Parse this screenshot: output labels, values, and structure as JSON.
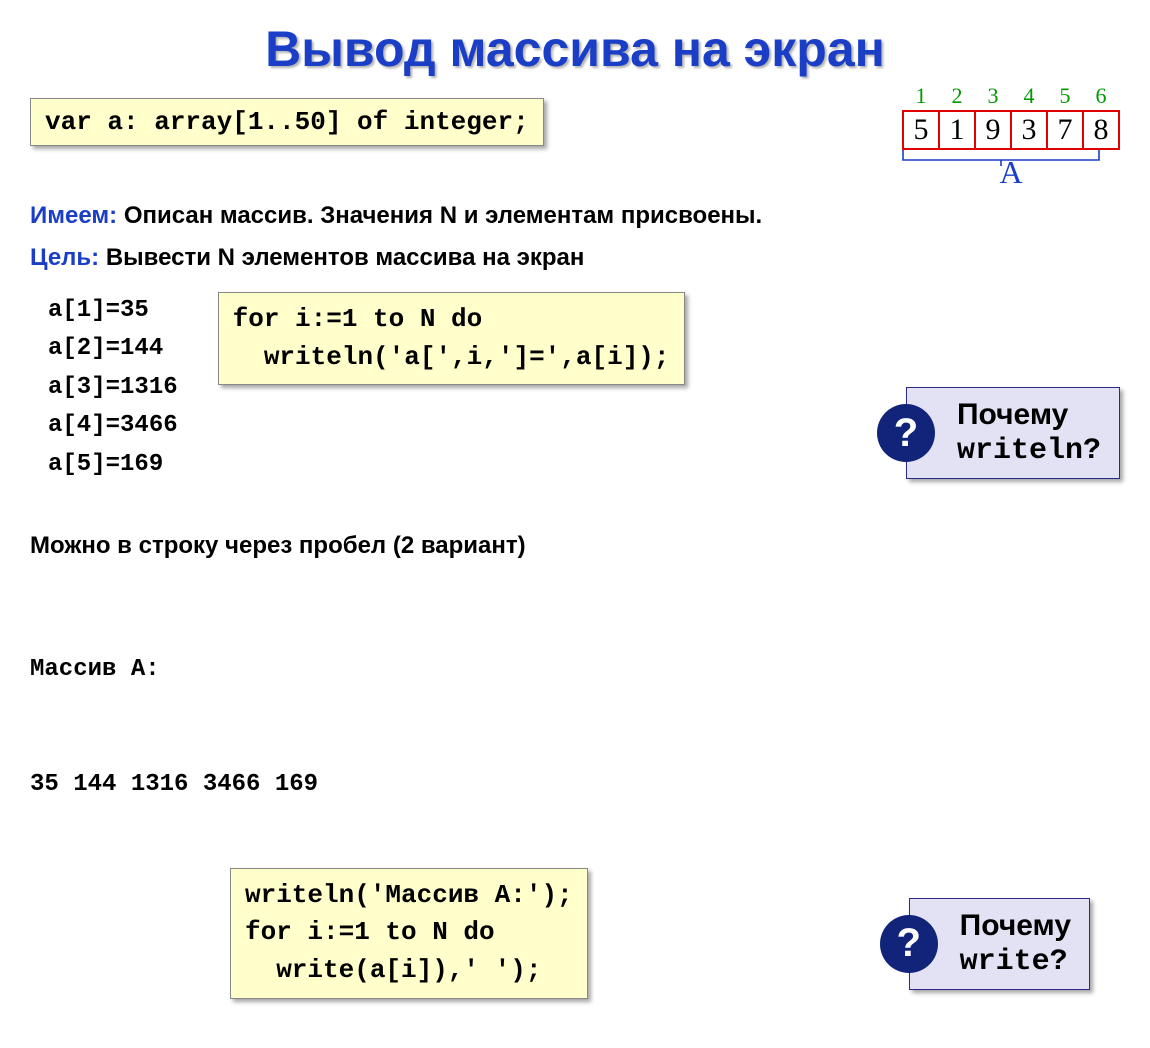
{
  "title": "Вывод массива на экран",
  "decl_code": "var a: array[1..50] of integer;",
  "array_vis": {
    "indices": [
      "1",
      "2",
      "3",
      "4",
      "5",
      "6"
    ],
    "values": [
      "5",
      "1",
      "9",
      "3",
      "7",
      "8"
    ],
    "label": "A"
  },
  "line_have": {
    "label": "Имеем:",
    "text": "Описан массив. Значения N и элементам присвоены."
  },
  "line_goal": {
    "label": "Цель:",
    "text": "Вывести N элементов массива на экран"
  },
  "col_list": "a[1]=35\na[2]=144\na[3]=1316\na[4]=3466\na[5]=169",
  "code_loop1": "for i:=1 to N do\n  writeln('a[',i,']=',a[i]);",
  "callout1": {
    "q": "?",
    "text1": "Почему",
    "text2": "writeln?"
  },
  "variant2_heading": "Можно в строку через пробел (2 вариант)",
  "variant2_out_label": "Массив A:",
  "variant2_out_values": "35 144 1316 3466 169",
  "code_loop2": "writeln('Массив A:');\nfor i:=1 to N do\n  write(a[i]),' ');",
  "callout2": {
    "q": "?",
    "text1": "Почему",
    "text2": "write?"
  }
}
